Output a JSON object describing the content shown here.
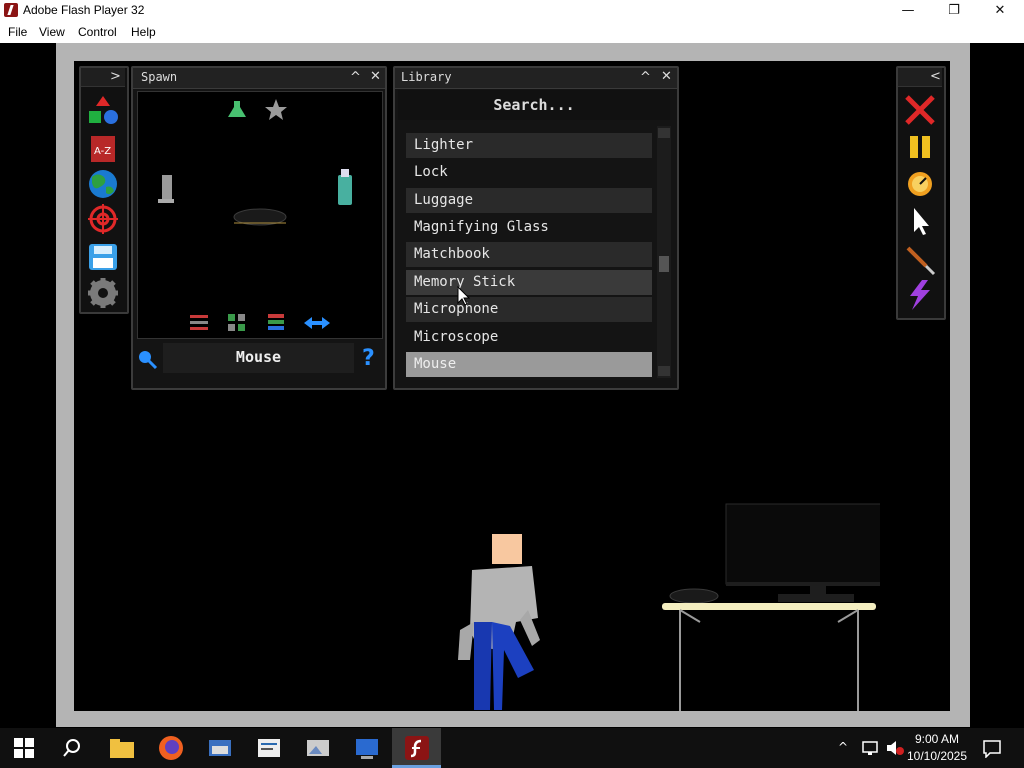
{
  "window": {
    "title": "Adobe Flash Player 32",
    "minimize": "—",
    "restore": "❐",
    "close": "✕"
  },
  "menu": [
    "File",
    "View",
    "Control",
    "Help"
  ],
  "spawn_panel": {
    "title": "Spawn",
    "selected_label": "Mouse",
    "help": "?"
  },
  "library_panel": {
    "title": "Library",
    "search_placeholder": "Search...",
    "items": [
      "Lighter",
      "Lock",
      "Luggage",
      "Magnifying Glass",
      "Matchbook",
      "Memory Stick",
      "Microphone",
      "Microscope",
      "Mouse"
    ]
  },
  "panel_buttons": {
    "collapse": "^",
    "close": "✕",
    "expand": ">",
    "collapse_left": "<"
  },
  "taskbar": {
    "time": "9:00 AM",
    "date": "10/10/2025"
  },
  "colors": {
    "accent_red": "#e02020",
    "flash_red": "#8b1414",
    "selected_row": "#9a9a9a"
  }
}
